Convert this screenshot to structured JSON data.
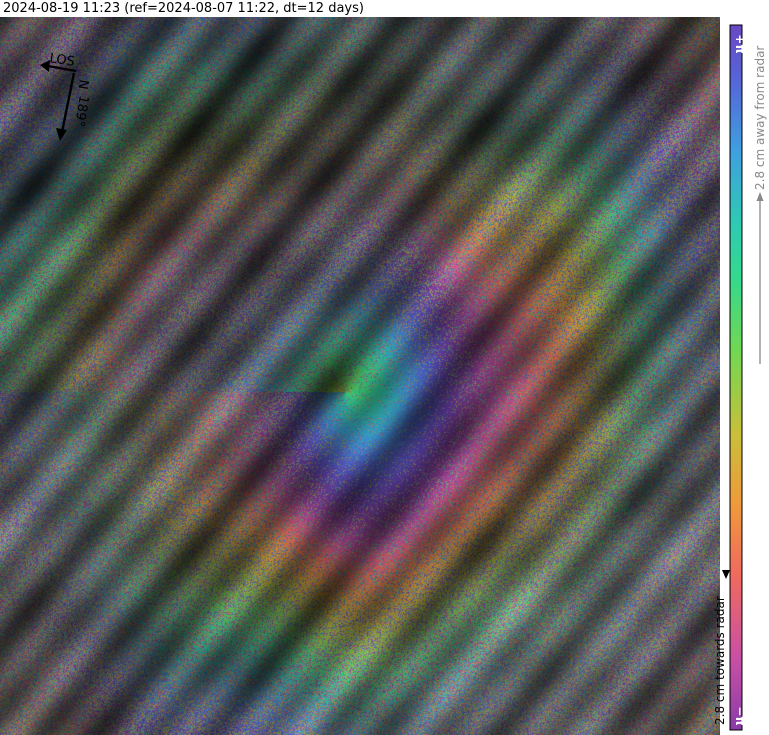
{
  "title": "2024-08-19 11:23 (ref=2024-08-07 11:22, dt=12 days)",
  "compass": {
    "los_label": "LOS",
    "north_label": "N",
    "heading_label": "189°"
  },
  "colorbar": {
    "top_label": "+π",
    "bottom_label": "−π",
    "away_label": "2.8 cm away from radar",
    "towards_label": "2.8 cm towards radar"
  },
  "colors": {
    "phase_cycle": [
      "#8e3fa3",
      "#c94fa5",
      "#f06a5e",
      "#f4a13a",
      "#c9bf3a",
      "#7fd64e",
      "#3ee07f",
      "#2fc9b4",
      "#3fa0e0",
      "#5566d8",
      "#6a48c4"
    ],
    "colorbar_outline": "#000000",
    "away_arrow": "#888888",
    "towards_arrow": "#000000"
  }
}
